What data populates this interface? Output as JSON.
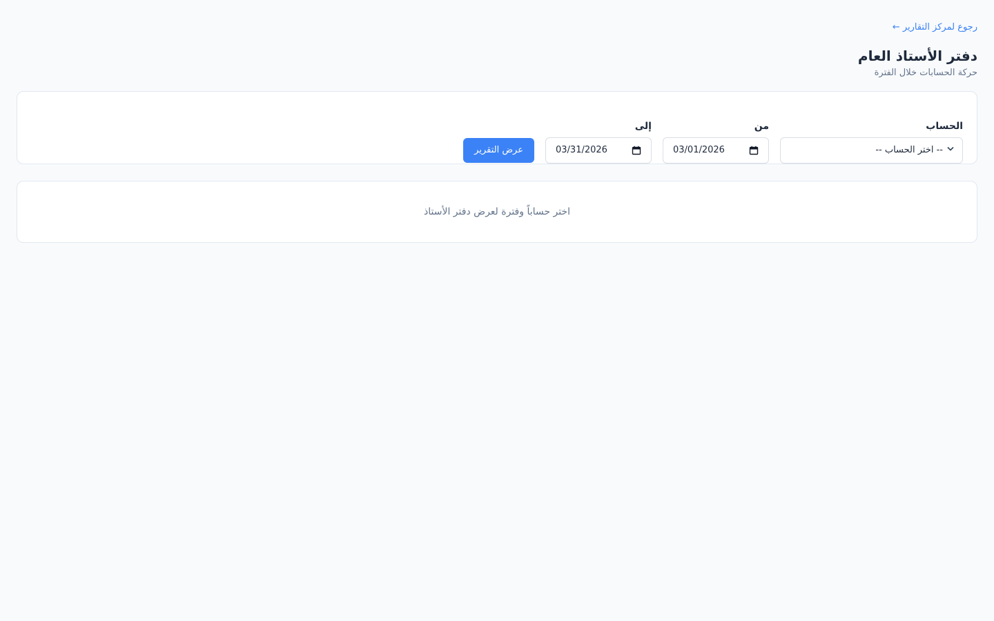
{
  "header": {
    "back_link": "رجوع لمركز التقارير",
    "back_arrow": "←",
    "title": "دفتر الأستاذ العام",
    "subtitle": "حركة الحسابات خلال الفترة"
  },
  "filters": {
    "account": {
      "label": "الحساب",
      "selected": "-- اختر الحساب --"
    },
    "from": {
      "label": "من",
      "value": "03/01/2026"
    },
    "to": {
      "label": "إلى",
      "value": "03/31/2026"
    },
    "submit_label": "عرض التقرير"
  },
  "empty_state": {
    "message": "اختر حساباً وفترة لعرض دفتر الأستاذ"
  },
  "colors": {
    "accent": "#3b82f6",
    "background": "#f8fafc",
    "card": "#ffffff",
    "muted_text": "#64748b"
  }
}
